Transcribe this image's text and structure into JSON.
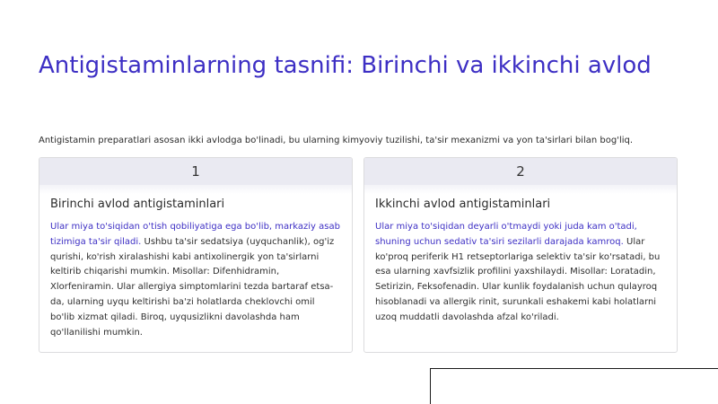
{
  "title": "Antigistaminlarning tasnifi: Birinchi va ikkinchi avlod",
  "intro": "Antigistamin preparatlari asosan ikki avlodga bo'linadi, bu ularning kimyoviy tuzilishi, ta'sir mexanizmi va yon ta'sirlari bilan bog'liq.",
  "cards": [
    {
      "number": "1",
      "heading": "Birinchi avlod antigistaminlari",
      "highlight": "Ular miya to'siqidan o'tish qobiliyatiga ega bo'lib, markaziy asab tizimiga ta'sir qiladi.",
      "body": " Ushbu ta'sir sedatsiya (uyquchanlik), og'iz qurishi, ko'rish xiralashishi kabi antixolinergik yon ta'sirlarni keltirib chiqarishi mumkin. Misollar: Difenhidramin, Xlorfeniramin. Ular allergiya simptomlarini tezda bartaraf etsa-da, ularning uyqu keltirishi ba'zi holatlarda cheklovchi omil bo'lib xizmat qiladi. Biroq, uyqusizlikni davolashda ham qo'llanilishi mumkin."
    },
    {
      "number": "2",
      "heading": "Ikkinchi avlod antigistaminlari",
      "highlight": "Ular miya to'siqidan deyarli o'tmaydi yoki juda kam o'tadi, shuning uchun sedativ ta'siri sezilarli darajada kamroq.",
      "body": " Ular ko'proq periferik H1 retseptorlariga selektiv ta'sir ko'rsatadi, bu esa ularning xavfsizlik profilini yaxshilaydi. Misollar: Loratadin, Setirizin, Feksofenadin. Ular kunlik foydalanish uchun qulayroq hisoblanadi va allergik rinit, surunkali eshakemi kabi holatlarni uzoq muddatli davolashda afzal ko'riladi."
    }
  ]
}
